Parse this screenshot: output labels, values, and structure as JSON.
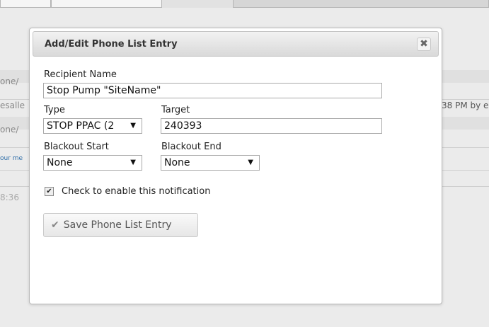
{
  "background": {
    "fragments": [
      "one/",
      "esalle",
      "one/",
      "our me",
      "8:36",
      "38 PM by e"
    ]
  },
  "dialog": {
    "title": "Add/Edit Phone List Entry",
    "close_glyph": "✖",
    "recipient_label": "Recipient Name",
    "recipient_value": "Stop Pump \"SiteName\"",
    "type_label": "Type",
    "type_value": "STOP PPAC (2",
    "target_label": "Target",
    "target_value": "240393",
    "blackout_start_label": "Blackout Start",
    "blackout_start_value": "None",
    "blackout_end_label": "Blackout End",
    "blackout_end_value": "None",
    "enable_label": "Check to enable this notification",
    "enable_checked": true,
    "save_label": "Save Phone List Entry",
    "dropdown_arrow": "▼",
    "check_glyph": "✔"
  }
}
